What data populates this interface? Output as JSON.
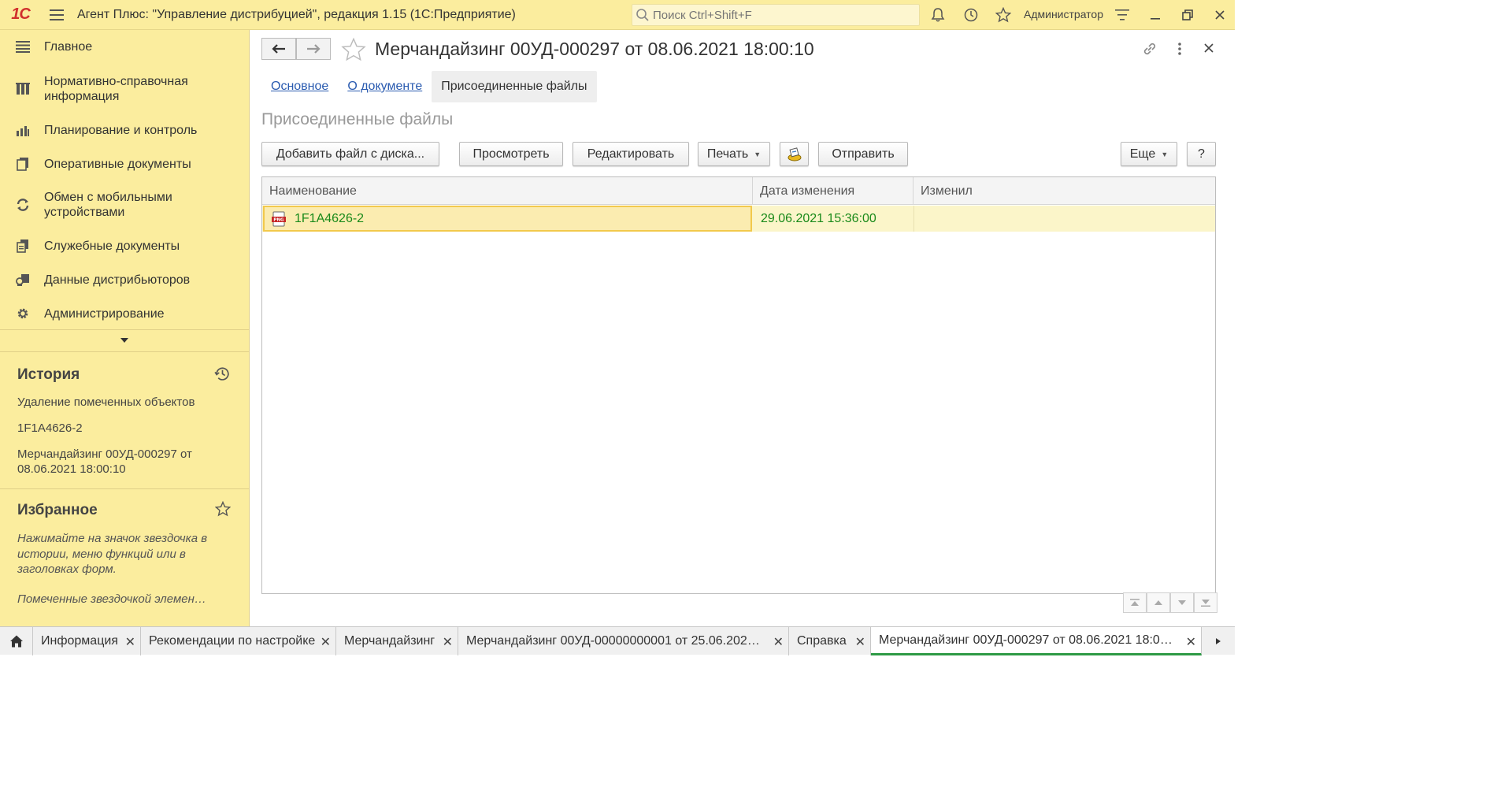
{
  "titlebar": {
    "logo": "1С",
    "title": "Агент Плюс: \"Управление дистрибуцией\", редакция 1.15  (1С:Предприятие)",
    "search_placeholder": "Поиск Ctrl+Shift+F",
    "user": "Администратор"
  },
  "sidebar": {
    "sections": [
      {
        "label": "Главное",
        "icon": "menu-lines-icon"
      },
      {
        "label": "Нормативно-справочная информация",
        "icon": "catalog-icon"
      },
      {
        "label": "Планирование и контроль",
        "icon": "bar-chart-icon"
      },
      {
        "label": "Оперативные документы",
        "icon": "documents-icon"
      },
      {
        "label": "Обмен с мобильными устройствами",
        "icon": "sync-icon"
      },
      {
        "label": "Служебные документы",
        "icon": "service-docs-icon"
      },
      {
        "label": "Данные дистрибьюторов",
        "icon": "distributor-data-icon"
      },
      {
        "label": "Администрирование",
        "icon": "gear-icon"
      }
    ],
    "history": {
      "title": "История",
      "items": [
        "Удаление помеченных объектов",
        "1F1A4626-2",
        "Мерчандайзинг 00УД-000297 от 08.06.2021 18:00:10"
      ]
    },
    "favorites": {
      "title": "Избранное",
      "hint1": "Нажимайте на значок звездочка в истории, меню функций или в заголовках форм.",
      "hint2": "Помеченные звездочкой элемен…"
    }
  },
  "document": {
    "title": "Мерчандайзинг 00УД-000297 от 08.06.2021 18:00:10",
    "tabs": [
      {
        "label": "Основное",
        "active": false
      },
      {
        "label": "О документе",
        "active": false
      },
      {
        "label": "Присоединенные файлы",
        "active": true
      }
    ],
    "section_title": "Присоединенные файлы",
    "toolbar": {
      "add_file": "Добавить файл с диска...",
      "view": "Просмотреть",
      "edit": "Редактировать",
      "print": "Печать",
      "send": "Отправить",
      "more": "Еще",
      "help": "?"
    },
    "table": {
      "columns": [
        "Наименование",
        "Дата изменения",
        "Изменил"
      ],
      "rows": [
        {
          "name": "1F1A4626-2",
          "file_type": "PNG",
          "modified": "29.06.2021 15:36:00",
          "modified_by": ""
        }
      ]
    }
  },
  "bottom_tabs": [
    {
      "label": "Информация",
      "active": false
    },
    {
      "label": "Рекомендации по настройке",
      "active": false
    },
    {
      "label": "Мерчандайзинг",
      "active": false
    },
    {
      "label": "Мерчандайзинг 00УД-00000000001 от 25.06.202…",
      "active": false
    },
    {
      "label": "Справка",
      "active": false
    },
    {
      "label": "Мерчандайзинг 00УД-000297 от 08.06.2021 18:0…",
      "active": true
    }
  ],
  "colors": {
    "panel_yellow": "#fbed9e",
    "link_blue": "#2a5bb0",
    "value_green": "#1a8a1a",
    "active_tab_green": "#2e9a45",
    "logo_red": "#d0312d"
  }
}
